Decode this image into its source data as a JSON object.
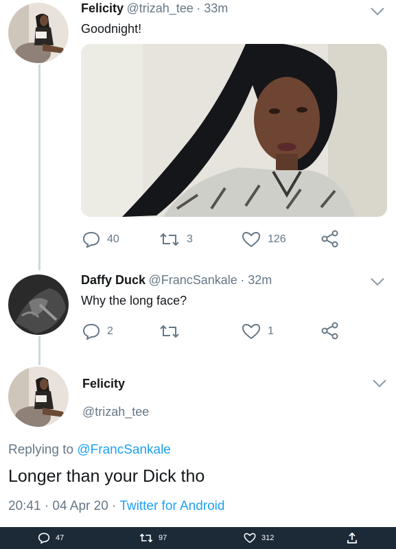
{
  "tweet1": {
    "name": "Felicity",
    "handle": "@trizah_tee",
    "time": "· 33m",
    "text": "Goodnight!",
    "reply_count": "40",
    "retweet_count": "3",
    "like_count": "126"
  },
  "tweet2": {
    "name": "Daffy Duck",
    "handle": "@FrancSankale",
    "time": "· 32m",
    "text": "Why the long face?",
    "reply_count": "2",
    "retweet_count": "",
    "like_count": "1"
  },
  "main_tweet": {
    "name": "Felicity",
    "handle": "@trizah_tee",
    "replying_prefix": "Replying to",
    "replying_to": "@FrancSankale",
    "text": "Longer than your Dick tho",
    "timestamp": "20:41 · 04 Apr 20 ·",
    "source": "Twitter for Android"
  },
  "bottom_bar": {
    "replies": "47",
    "retweets": "97",
    "likes": "312"
  },
  "colors": {
    "link": "#1da1f2",
    "muted": "#657786",
    "text": "#14171a",
    "bar": "#1c2a38"
  },
  "icons": [
    "chevron-down-icon",
    "reply-icon",
    "retweet-icon",
    "like-icon",
    "share-icon"
  ]
}
